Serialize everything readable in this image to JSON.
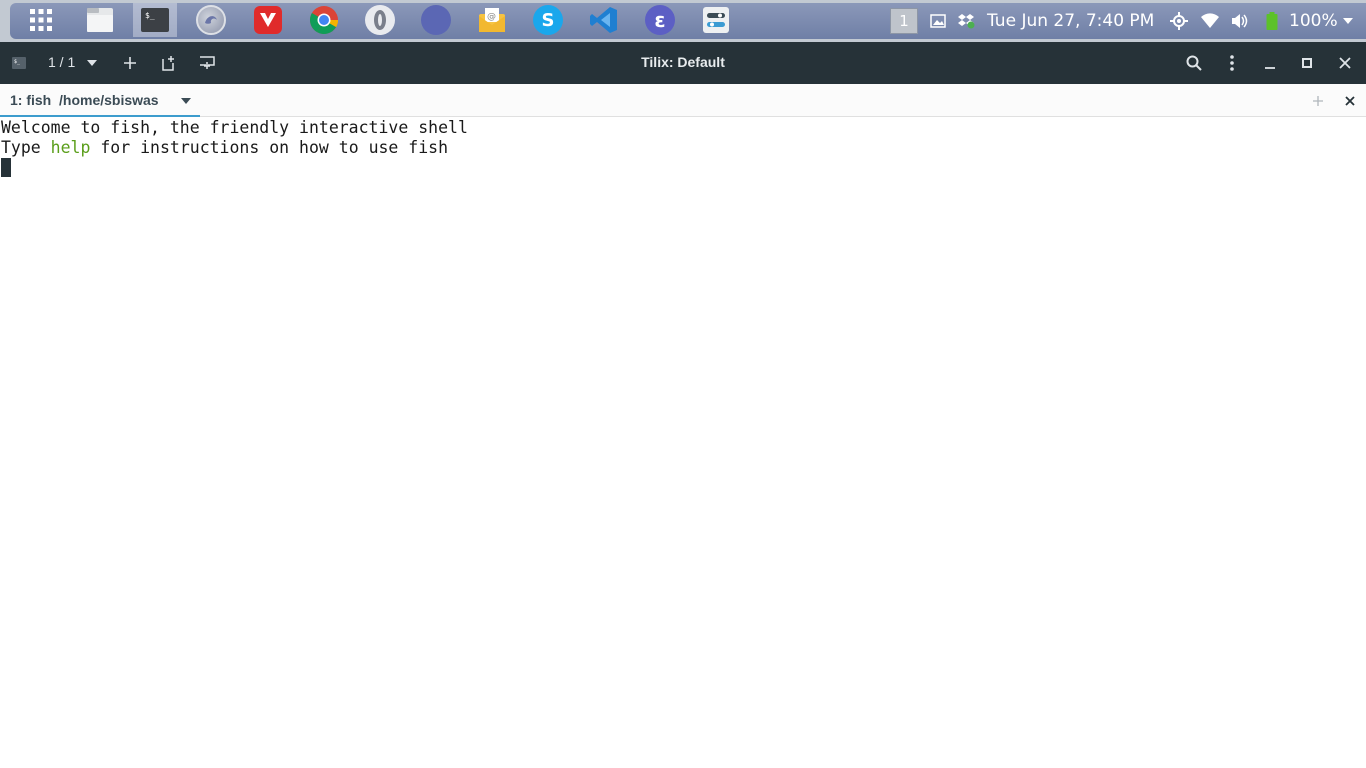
{
  "panel": {
    "workspace_number": "1",
    "clock": "Tue Jun 27,  7:40 PM",
    "battery_percent": "100%",
    "dock_icons": [
      "app-grid-icon",
      "files-icon",
      "terminal-icon",
      "firefox-icon",
      "vivaldi-icon",
      "chrome-icon",
      "opera-icon",
      "compass-icon",
      "mail-icon",
      "skype-icon",
      "vscode-icon",
      "epiphany-icon",
      "settings-icon"
    ],
    "accent_colors": {
      "panel_bar": "#7c8aae",
      "battery": "#5cc12a"
    }
  },
  "headerbar": {
    "session_counter": "1 / 1",
    "title": "Tilix: Default"
  },
  "tabbar": {
    "tab_number": "1: fish",
    "tab_path": "/home/sbiswas"
  },
  "terminal": {
    "line1": "Welcome to fish, the friendly interactive shell",
    "line2_prefix": "Type ",
    "line2_keyword": "help",
    "line2_suffix": " for instructions on how to use fish"
  }
}
